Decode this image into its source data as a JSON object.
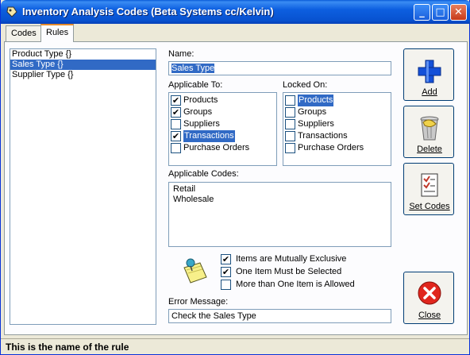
{
  "window": {
    "title": "Inventory Analysis Codes (Beta Systems cc/Kelvin)",
    "controls": {
      "minimize": "_",
      "maximize": "□",
      "close": "✕"
    }
  },
  "tabs": [
    "Codes",
    "Rules"
  ],
  "active_tab": "Rules",
  "rules_list": [
    {
      "label": "Product Type {}",
      "selected": false
    },
    {
      "label": "Sales Type {}",
      "selected": true
    },
    {
      "label": "Supplier Type {}",
      "selected": false
    }
  ],
  "name": {
    "label": "Name:",
    "value": "Sales Type"
  },
  "applicable_to": {
    "label": "Applicable To:",
    "items": [
      {
        "label": "Products",
        "checked": true,
        "selected": false
      },
      {
        "label": "Groups",
        "checked": true,
        "selected": false
      },
      {
        "label": "Suppliers",
        "checked": false,
        "selected": false
      },
      {
        "label": "Transactions",
        "checked": true,
        "selected": true
      },
      {
        "label": "Purchase Orders",
        "checked": false,
        "selected": false
      }
    ]
  },
  "locked_on": {
    "label": "Locked On:",
    "items": [
      {
        "label": "Products",
        "checked": false,
        "selected": true
      },
      {
        "label": "Groups",
        "checked": false,
        "selected": false
      },
      {
        "label": "Suppliers",
        "checked": false,
        "selected": false
      },
      {
        "label": "Transactions",
        "checked": false,
        "selected": false
      },
      {
        "label": "Purchase Orders",
        "checked": false,
        "selected": false
      }
    ]
  },
  "applicable_codes": {
    "label": "Applicable Codes:",
    "lines": [
      "Retail",
      "Wholesale"
    ]
  },
  "options": [
    {
      "label": "Items are Mutually Exclusive",
      "checked": true
    },
    {
      "label": "One Item Must be Selected",
      "checked": true
    },
    {
      "label": "More than One Item is Allowed",
      "checked": false
    }
  ],
  "error_message": {
    "label": "Error Message:",
    "value": "Check the Sales Type"
  },
  "buttons": {
    "add": "Add",
    "delete": "Delete",
    "set_codes": "Set Codes",
    "close": "Close"
  },
  "icons": {
    "add": "plus-icon",
    "delete": "trash-can-icon",
    "set_codes": "checklist-icon",
    "close": "close-circle-icon",
    "note": "sticky-note-pin-icon"
  },
  "status": "This is the name of the rule"
}
